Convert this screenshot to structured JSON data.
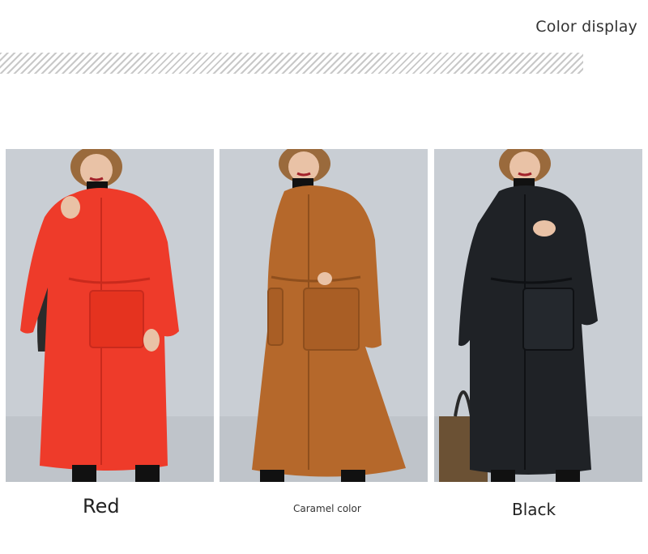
{
  "header": {
    "title": "Color display"
  },
  "products": [
    {
      "label": "Red",
      "coat_color": "#ee3b2a",
      "coat_shade": "#c92a1d"
    },
    {
      "label": "Caramel color",
      "coat_color": "#b5682b",
      "coat_shade": "#8f4f1d"
    },
    {
      "label": "Black",
      "coat_color": "#1f2226",
      "coat_shade": "#0f1114"
    }
  ],
  "colors": {
    "background": "#ffffff",
    "photo_backdrop": "#c7ccd2",
    "hatch": "#c8c8c8"
  }
}
